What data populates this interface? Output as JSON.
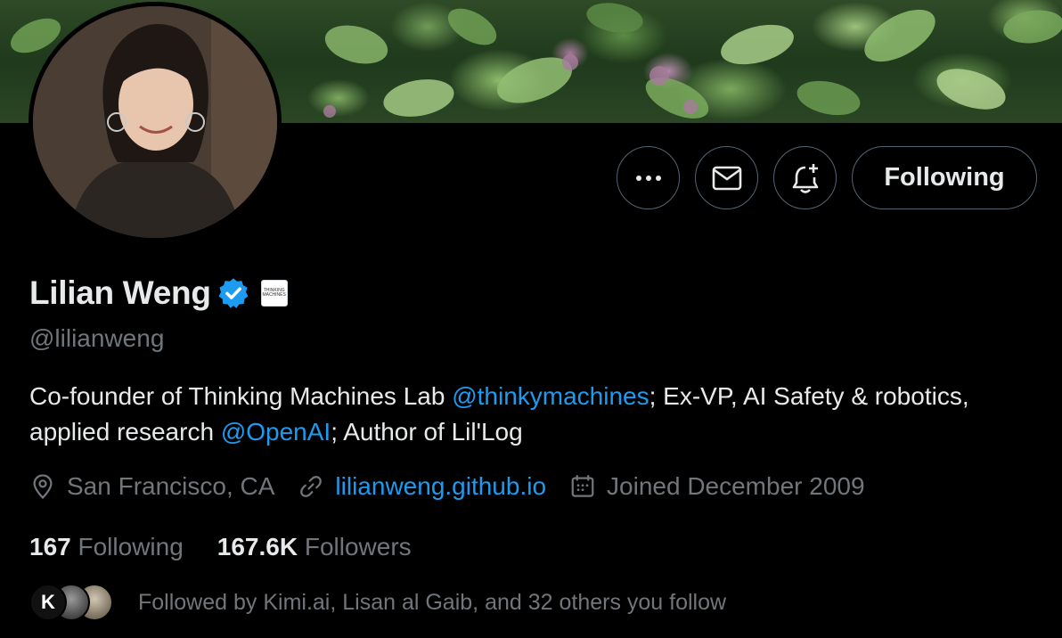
{
  "profile": {
    "name": "Lilian Weng",
    "handle": "@lilianweng",
    "affiliation_badge_text": "THINKING MACHINES",
    "bio": {
      "part1": "Co-founder of Thinking Machines Lab ",
      "mention1": "@thinkymachines",
      "part2": "; Ex-VP, AI Safety & robotics, applied research ",
      "mention2": "@OpenAI",
      "part3": "; Author of Lil'Log"
    },
    "location": "San Francisco, CA",
    "website": "lilianweng.github.io",
    "joined": "Joined December 2009"
  },
  "actions": {
    "more_icon": "more-dots-icon",
    "message_icon": "envelope-icon",
    "notify_icon": "bell-plus-icon",
    "follow_label": "Following"
  },
  "stats": {
    "following_count": "167",
    "following_label": "Following",
    "followers_count": "167.6K",
    "followers_label": "Followers"
  },
  "followed_by": {
    "avatar1_letter": "K",
    "text": "Followed by Kimi.ai, Lisan al Gaib, and 32 others you follow"
  },
  "colors": {
    "accent": "#1d9bf0",
    "muted": "#71767b",
    "text": "#e7e9ea",
    "border": "#536471"
  }
}
